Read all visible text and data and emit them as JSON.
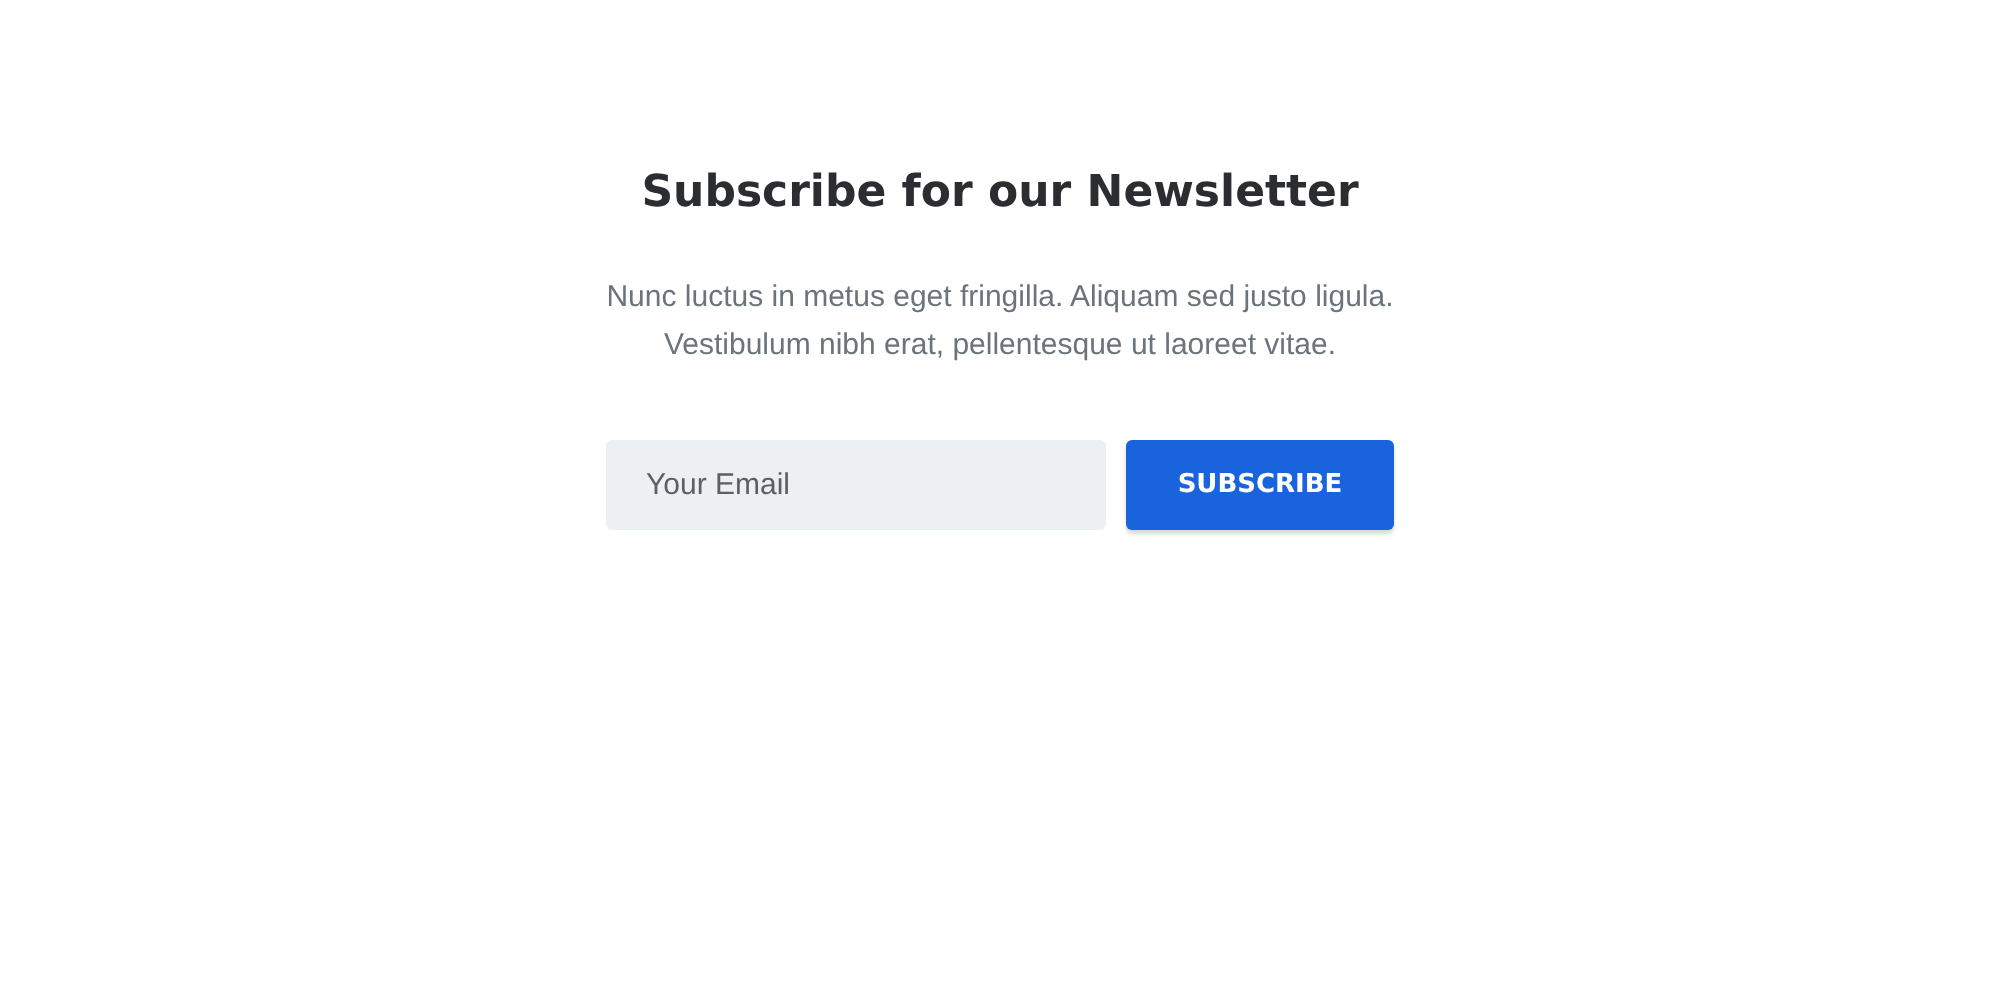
{
  "title": "Subscribe for our Newsletter",
  "description": [
    "Nunc luctus in metus eget fringilla. Aliquam sed justo ligula.",
    "Vestibulum nibh erat, pellentesque ut laoreet vitae."
  ],
  "form": {
    "email": {
      "placeholder": "Your Email"
    },
    "button": "SUBSCRIBE"
  }
}
